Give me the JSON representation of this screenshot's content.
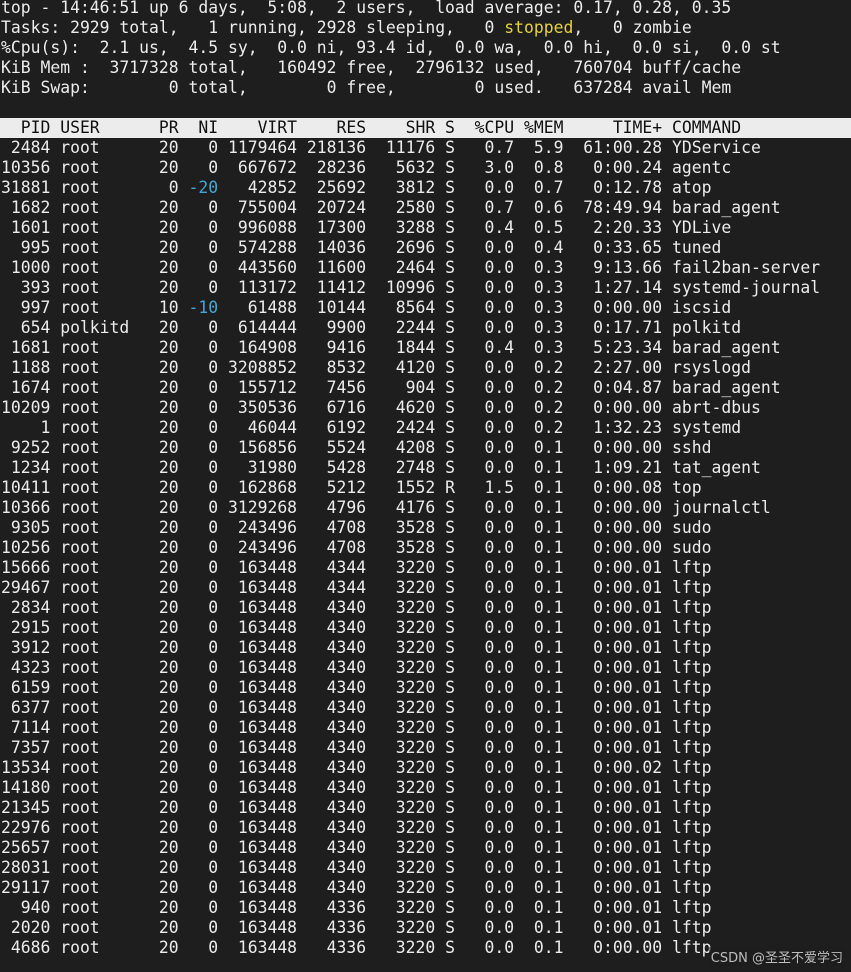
{
  "summary": {
    "line1": "top - 14:46:51 up 6 days,  5:08,  2 users,  load average: 0.17, 0.28, 0.35",
    "tasks_prefix": "Tasks: 2929 total,   1 running, 2928 sleeping,   0 ",
    "tasks_stopped_word": "stopped",
    "tasks_suffix": ",   0 zombie",
    "cpu": "%Cpu(s):  2.1 us,  4.5 sy,  0.0 ni, 93.4 id,  0.0 wa,  0.0 hi,  0.0 si,  0.0 st",
    "mem": "KiB Mem :  3717328 total,   160492 free,  2796132 used,   760704 buff/cache",
    "swap": "KiB Swap:        0 total,        0 free,        0 used.   637284 avail Mem"
  },
  "table": {
    "header": "  PID USER      PR  NI    VIRT    RES    SHR S  %CPU %MEM     TIME+ COMMAND",
    "rows": [
      {
        "pre": " 2484 root      20   0",
        "post": " 1179464 218136  11176 S   0.7  5.9  61:00.28 YDService"
      },
      {
        "pre": "10356 root      20   0",
        "post": "  667672  28236   5632 S   3.0  0.8   0:00.24 agentc"
      },
      {
        "pre": "31881 root       0 ",
        "neg": "-20",
        "post": "   42852  25692   3812 S   0.0  0.7   0:12.78 atop"
      },
      {
        "pre": " 1682 root      20   0",
        "post": "  755004  20724   2580 S   0.7  0.6  78:49.94 barad_agent"
      },
      {
        "pre": " 1601 root      20   0",
        "post": "  996088  17300   3288 S   0.4  0.5   2:20.33 YDLive"
      },
      {
        "pre": "  995 root      20   0",
        "post": "  574288  14036   2696 S   0.0  0.4   0:33.65 tuned"
      },
      {
        "pre": " 1000 root      20   0",
        "post": "  443560  11600   2464 S   0.0  0.3   9:13.66 fail2ban-server"
      },
      {
        "pre": "  393 root      20   0",
        "post": "  113172  11412  10996 S   0.0  0.3   1:27.14 systemd-journal"
      },
      {
        "pre": "  997 root      10 ",
        "neg": "-10",
        "post": "   61488  10144   8564 S   0.0  0.3   0:00.00 iscsid"
      },
      {
        "pre": "  654 polkitd   20   0",
        "post": "  614444   9900   2244 S   0.0  0.3   0:17.71 polkitd"
      },
      {
        "pre": " 1681 root      20   0",
        "post": "  164908   9416   1844 S   0.4  0.3   5:23.34 barad_agent"
      },
      {
        "pre": " 1188 root      20   0",
        "post": " 3208852   8532   4120 S   0.0  0.2   2:27.00 rsyslogd"
      },
      {
        "pre": " 1674 root      20   0",
        "post": "  155712   7456    904 S   0.0  0.2   0:04.87 barad_agent"
      },
      {
        "pre": "10209 root      20   0",
        "post": "  350536   6716   4620 S   0.0  0.2   0:00.00 abrt-dbus"
      },
      {
        "pre": "    1 root      20   0",
        "post": "   46044   6192   2424 S   0.0  0.2   1:32.23 systemd"
      },
      {
        "pre": " 9252 root      20   0",
        "post": "  156856   5524   4208 S   0.0  0.1   0:00.00 sshd"
      },
      {
        "pre": " 1234 root      20   0",
        "post": "   31980   5428   2748 S   0.0  0.1   1:09.21 tat_agent"
      },
      {
        "pre": "10411 root      20   0",
        "post": "  162868   5212   1552 R   1.5  0.1   0:00.08 top"
      },
      {
        "pre": "10366 root      20   0",
        "post": " 3129268   4796   4176 S   0.0  0.1   0:00.00 journalctl"
      },
      {
        "pre": " 9305 root      20   0",
        "post": "  243496   4708   3528 S   0.0  0.1   0:00.00 sudo"
      },
      {
        "pre": "10256 root      20   0",
        "post": "  243496   4708   3528 S   0.0  0.1   0:00.00 sudo"
      },
      {
        "pre": "15666 root      20   0",
        "post": "  163448   4344   3220 S   0.0  0.1   0:00.01 lftp"
      },
      {
        "pre": "29467 root      20   0",
        "post": "  163448   4344   3220 S   0.0  0.1   0:00.01 lftp"
      },
      {
        "pre": " 2834 root      20   0",
        "post": "  163448   4340   3220 S   0.0  0.1   0:00.01 lftp"
      },
      {
        "pre": " 2915 root      20   0",
        "post": "  163448   4340   3220 S   0.0  0.1   0:00.01 lftp"
      },
      {
        "pre": " 3912 root      20   0",
        "post": "  163448   4340   3220 S   0.0  0.1   0:00.01 lftp"
      },
      {
        "pre": " 4323 root      20   0",
        "post": "  163448   4340   3220 S   0.0  0.1   0:00.01 lftp"
      },
      {
        "pre": " 6159 root      20   0",
        "post": "  163448   4340   3220 S   0.0  0.1   0:00.01 lftp"
      },
      {
        "pre": " 6377 root      20   0",
        "post": "  163448   4340   3220 S   0.0  0.1   0:00.01 lftp"
      },
      {
        "pre": " 7114 root      20   0",
        "post": "  163448   4340   3220 S   0.0  0.1   0:00.01 lftp"
      },
      {
        "pre": " 7357 root      20   0",
        "post": "  163448   4340   3220 S   0.0  0.1   0:00.01 lftp"
      },
      {
        "pre": "13534 root      20   0",
        "post": "  163448   4340   3220 S   0.0  0.1   0:00.02 lftp"
      },
      {
        "pre": "14180 root      20   0",
        "post": "  163448   4340   3220 S   0.0  0.1   0:00.01 lftp"
      },
      {
        "pre": "21345 root      20   0",
        "post": "  163448   4340   3220 S   0.0  0.1   0:00.01 lftp"
      },
      {
        "pre": "22976 root      20   0",
        "post": "  163448   4340   3220 S   0.0  0.1   0:00.01 lftp"
      },
      {
        "pre": "25657 root      20   0",
        "post": "  163448   4340   3220 S   0.0  0.1   0:00.01 lftp"
      },
      {
        "pre": "28031 root      20   0",
        "post": "  163448   4340   3220 S   0.0  0.1   0:00.01 lftp"
      },
      {
        "pre": "29117 root      20   0",
        "post": "  163448   4340   3220 S   0.0  0.1   0:00.01 lftp"
      },
      {
        "pre": "  940 root      20   0",
        "post": "  163448   4336   3220 S   0.0  0.1   0:00.01 lftp"
      },
      {
        "pre": " 2020 root      20   0",
        "post": "  163448   4336   3220 S   0.0  0.1   0:00.01 lftp"
      },
      {
        "pre": " 4686 root      20   0",
        "post": "  163448   4336   3220 S   0.0  0.1   0:00.00 lftp"
      }
    ]
  },
  "watermark": "CSDN @圣圣不爱学习",
  "colors": {
    "background": "#1e1e1e",
    "text": "#ececec",
    "header_bg": "#ececec",
    "header_text": "#111111",
    "stopped": "#e5d23d",
    "negative_nice": "#42a7d8"
  }
}
